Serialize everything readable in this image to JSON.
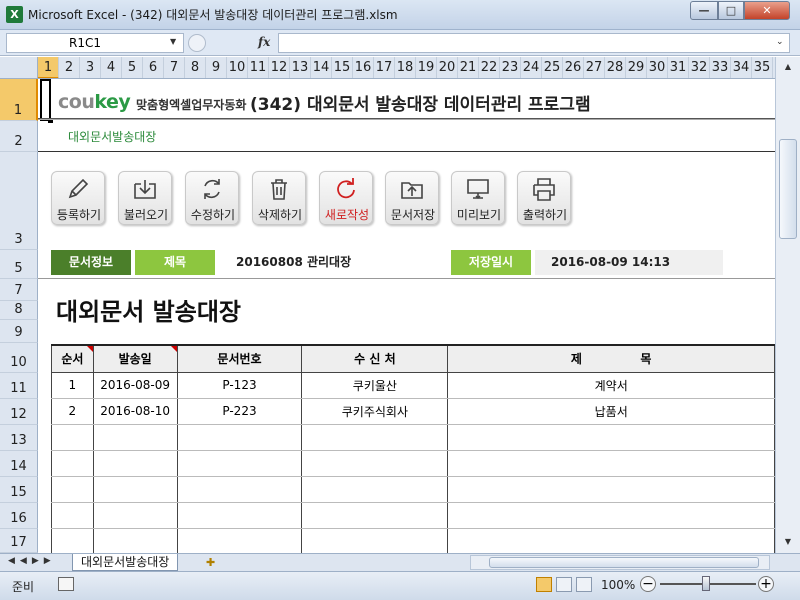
{
  "window": {
    "title": "Microsoft Excel - (342) 대외문서 발송대장 데이터관리 프로그램.xlsm",
    "app_icon": "X",
    "minimize": "—",
    "maximize": "□",
    "close": "✕"
  },
  "formula_bar": {
    "name_box": "R1C1",
    "fx": "fx",
    "value": ""
  },
  "columns": [
    "1",
    "2",
    "3",
    "4",
    "5",
    "6",
    "7",
    "8",
    "9",
    "10",
    "11",
    "12",
    "13",
    "14",
    "15",
    "16",
    "17",
    "18",
    "19",
    "20",
    "21",
    "22",
    "23",
    "24",
    "25",
    "26",
    "27",
    "28",
    "29",
    "30",
    "31",
    "32",
    "33",
    "34",
    "35",
    "3"
  ],
  "rows": [
    "1",
    "2",
    "3",
    "5",
    "7",
    "8",
    "9",
    "10",
    "11",
    "12",
    "13",
    "14",
    "15",
    "16",
    "17"
  ],
  "header": {
    "logo_prefix": "cou",
    "logo_key": "key",
    "tagline": "맞춤형엑셀업무자동화",
    "program_title": "(342) 대외문서 발송대장 데이터관리 프로그램",
    "subtitle": "대외문서발송대장"
  },
  "toolbar": [
    {
      "name": "register",
      "label": "등록하기",
      "icon": "pencil-icon"
    },
    {
      "name": "load",
      "label": "불러오기",
      "icon": "download-icon"
    },
    {
      "name": "edit",
      "label": "수정하기",
      "icon": "refresh-icon"
    },
    {
      "name": "delete",
      "label": "삭제하기",
      "icon": "trash-icon"
    },
    {
      "name": "new",
      "label": "새로작성",
      "icon": "reload-icon",
      "highlight": "#d02020"
    },
    {
      "name": "save",
      "label": "문서저장",
      "icon": "upload-icon"
    },
    {
      "name": "preview",
      "label": "미리보기",
      "icon": "monitor-icon"
    },
    {
      "name": "print",
      "label": "출력하기",
      "icon": "printer-icon"
    }
  ],
  "doc_info": {
    "section_label": "문서정보",
    "title_label": "제목",
    "title_value": "20160808 관리대장",
    "saved_label": "저장일시",
    "saved_value": "2016-08-09 14:13"
  },
  "doc_heading": "대외문서 발송대장",
  "table": {
    "headers": [
      "순서",
      "발송일",
      "문서번호",
      "수 신 처",
      "제              목"
    ],
    "rows": [
      [
        "1",
        "2016-08-09",
        "P-123",
        "쿠키울산",
        "계약서"
      ],
      [
        "2",
        "2016-08-10",
        "P-223",
        "쿠키주식회사",
        "납품서"
      ],
      [
        "",
        "",
        "",
        "",
        ""
      ],
      [
        "",
        "",
        "",
        "",
        ""
      ],
      [
        "",
        "",
        "",
        "",
        ""
      ],
      [
        "",
        "",
        "",
        "",
        ""
      ],
      [
        "",
        "",
        "",
        "",
        ""
      ]
    ]
  },
  "sheet_tab": "대외문서발송대장",
  "status": {
    "ready": "준비",
    "zoom": "100%"
  },
  "colors": {
    "dark_green": "#4b7f2a",
    "light_green": "#8dc63f",
    "accent_red": "#d02020"
  }
}
